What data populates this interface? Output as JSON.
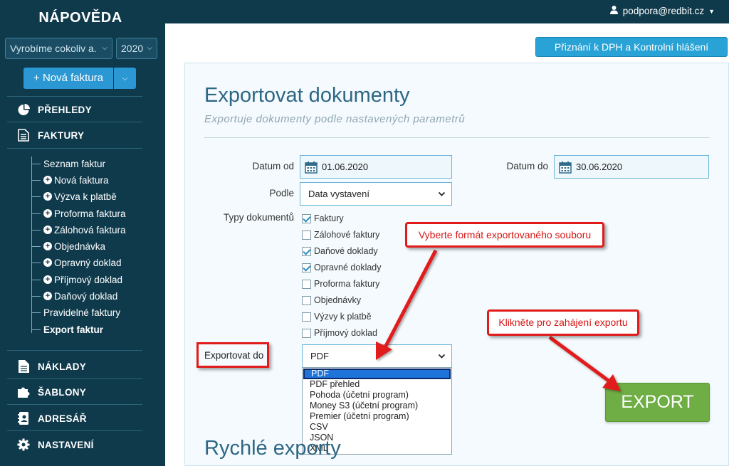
{
  "sidebar": {
    "brand": "NÁPOVĚDA",
    "company_select": "Vyrobíme cokoliv a. s.",
    "year_select": "2020",
    "new_invoice_button": "+ Nová faktura",
    "nav": [
      {
        "label": "PŘEHLEDY",
        "icon": "pie-chart-icon"
      },
      {
        "label": "FAKTURY",
        "icon": "document-icon"
      },
      {
        "label": "NÁKLADY",
        "icon": "file-icon"
      },
      {
        "label": "ŠABLONY",
        "icon": "puzzle-icon"
      },
      {
        "label": "ADRESÁŘ",
        "icon": "address-book-icon"
      },
      {
        "label": "NASTAVENÍ",
        "icon": "gear-icon"
      }
    ],
    "sub_items": [
      {
        "label": "Seznam faktur",
        "plus": false
      },
      {
        "label": "Nová faktura",
        "plus": true
      },
      {
        "label": "Výzva k platbě",
        "plus": true
      },
      {
        "label": "Proforma faktura",
        "plus": true
      },
      {
        "label": "Zálohová faktura",
        "plus": true
      },
      {
        "label": "Objednávka",
        "plus": true
      },
      {
        "label": "Opravný doklad",
        "plus": true
      },
      {
        "label": "Příjmový doklad",
        "plus": true
      },
      {
        "label": "Daňový doklad",
        "plus": true
      },
      {
        "label": "Pravidelné faktury",
        "plus": false
      },
      {
        "label": "Export faktur",
        "plus": false,
        "active": true
      }
    ]
  },
  "header": {
    "user": "podpora@redbit.cz",
    "vat_button": "Přiznání k DPH a Kontrolní hlášení"
  },
  "main": {
    "title": "Exportovat dokumenty",
    "subtitle": "Exportuje dokumenty podle nastavených parametrů",
    "date_from_label": "Datum od",
    "date_from_value": "01.06.2020",
    "date_to_label": "Datum do",
    "date_to_value": "30.06.2020",
    "by_label": "Podle",
    "by_value": "Data vystavení",
    "types_label": "Typy dokumentů",
    "types": [
      {
        "label": "Faktury",
        "checked": true
      },
      {
        "label": "Zálohové faktury",
        "checked": false
      },
      {
        "label": "Daňové doklady",
        "checked": true
      },
      {
        "label": "Opravné doklady",
        "checked": true
      },
      {
        "label": "Proforma faktury",
        "checked": false
      },
      {
        "label": "Objednávky",
        "checked": false
      },
      {
        "label": "Výzvy k platbě",
        "checked": false
      },
      {
        "label": "Příjmový doklad",
        "checked": false
      }
    ],
    "export_to_label": "Exportovat do",
    "export_to_value": "PDF",
    "export_options": [
      "PDF",
      "PDF přehled",
      "Pohoda (účetní program)",
      "Money S3 (účetní program)",
      "Premier (účetní program)",
      "CSV",
      "JSON",
      "XML"
    ],
    "export_button": "EXPORT",
    "quick_exports_title": "Rychlé exporty"
  },
  "annotations": {
    "format_callout": "Vyberte formát exportovaného souboru",
    "export_callout": "Klikněte pro zahájení exportu"
  },
  "colors": {
    "sidebar_bg": "#0f3a4c",
    "accent_blue": "#29a2d6",
    "export_green": "#6fae45",
    "callout_red": "#e11a1a"
  }
}
